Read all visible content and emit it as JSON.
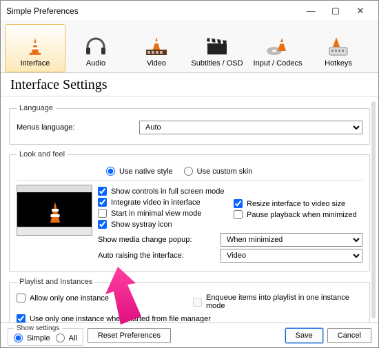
{
  "window": {
    "title": "Simple Preferences"
  },
  "tabs": [
    {
      "label": "Interface"
    },
    {
      "label": "Audio"
    },
    {
      "label": "Video"
    },
    {
      "label": "Subtitles / OSD"
    },
    {
      "label": "Input / Codecs"
    },
    {
      "label": "Hotkeys"
    }
  ],
  "heading": "Interface Settings",
  "language": {
    "legend": "Language",
    "menus_label": "Menus language:",
    "value": "Auto"
  },
  "lookfeel": {
    "legend": "Look and feel",
    "use_native": "Use native style",
    "use_custom": "Use custom skin",
    "show_controls": "Show controls in full screen mode",
    "integrate_video": "Integrate video in interface",
    "resize_interface": "Resize interface to video size",
    "minimal_view": "Start in minimal view mode",
    "pause_minimized": "Pause playback when minimized",
    "systray": "Show systray icon",
    "media_change_label": "Show media change popup:",
    "media_change_value": "When minimized",
    "auto_raise_label": "Auto raising the interface:",
    "auto_raise_value": "Video"
  },
  "playlist": {
    "legend": "Playlist and Instances",
    "allow_one": "Allow only one instance",
    "enqueue": "Enqueue items into playlist in one instance mode",
    "use_one_fm": "Use only one instance when started from file manager"
  },
  "footer": {
    "show_settings": "Show settings",
    "simple": "Simple",
    "all": "All",
    "reset": "Reset Preferences",
    "save": "Save",
    "cancel": "Cancel"
  }
}
